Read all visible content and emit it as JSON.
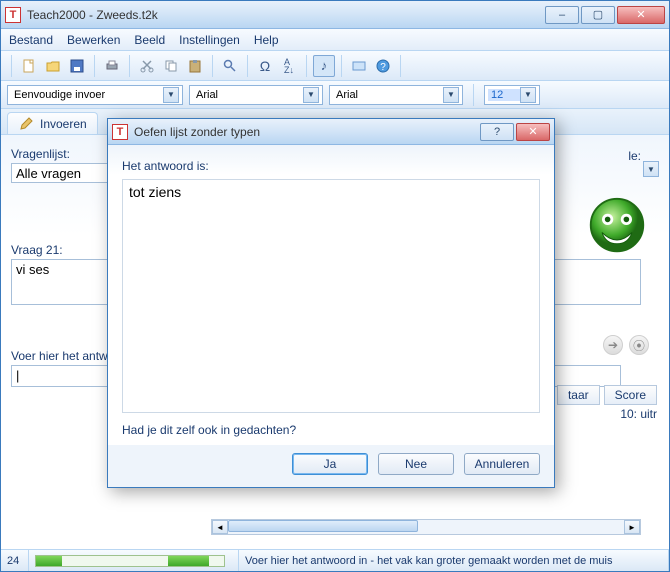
{
  "window": {
    "title": "Teach2000  -  Zweeds.t2k",
    "buttons": {
      "min": "–",
      "max": "▢",
      "close": "✕"
    }
  },
  "menu": [
    "Bestand",
    "Bewerken",
    "Beeld",
    "Instellingen",
    "Help"
  ],
  "controlbar": {
    "mode": "Eenvoudige invoer",
    "font1": "Arial",
    "font2": "Arial",
    "fontsize": "12"
  },
  "tab": {
    "label": "Invoeren"
  },
  "main": {
    "vragenlijst_label": "Vragenlijst:",
    "vragenlijst_value": "Alle vragen",
    "vraag_label": "Vraag 21:",
    "vraag_value": "vi ses",
    "antwoord_label": "Voer hier het antw",
    "antwoord_cursor": "|",
    "right_label": "le:",
    "table": {
      "col1": "taar",
      "col2": "Score",
      "row1": "10: uitr"
    }
  },
  "statusbar": {
    "count": "24",
    "hint": "Voer hier het antwoord in - het vak kan groter gemaakt worden met de muis"
  },
  "dialog": {
    "title": "Oefen lijst zonder typen",
    "help": "?",
    "close": "✕",
    "label": "Het antwoord is:",
    "answer": "tot ziens",
    "question": "Had je dit zelf ook in gedachten?",
    "btn_yes": "Ja",
    "btn_no": "Nee",
    "btn_cancel": "Annuleren"
  }
}
